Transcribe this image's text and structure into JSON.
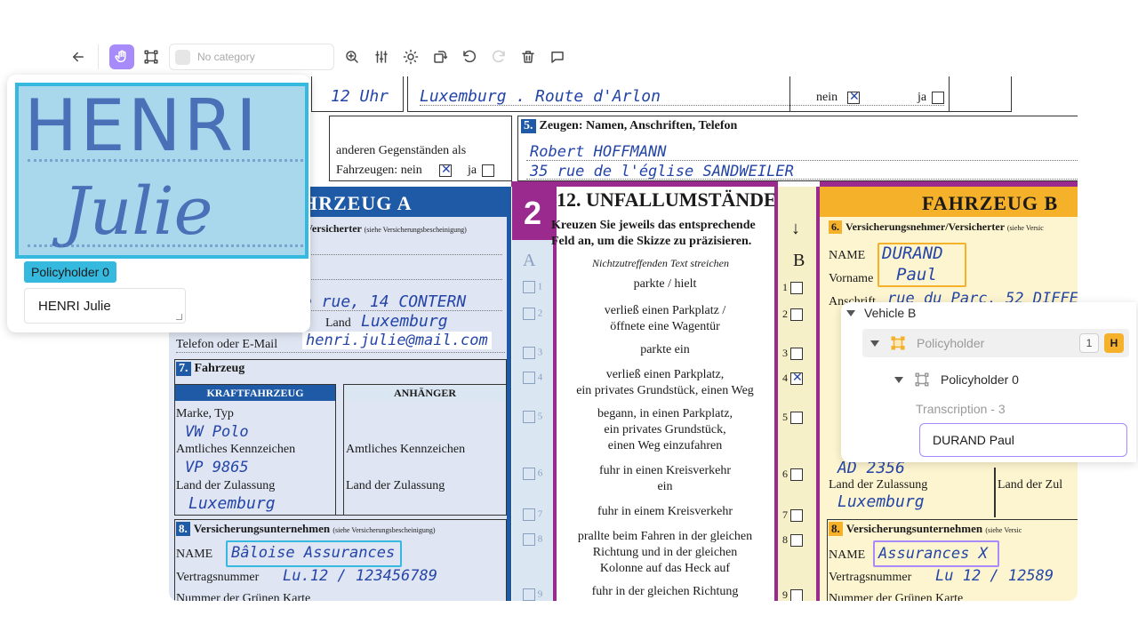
{
  "toolbar": {
    "category_placeholder": "No category"
  },
  "doc": {
    "uhr": "12 Uhr",
    "place_hw": "Luxemburg . Route d'Arlon",
    "nein": "nein",
    "ja": "ja",
    "sec5_num": "5.",
    "sec5_title": "Zeugen: Namen, Anschriften, Telefon",
    "witness_line1": "Robert HOFFMANN",
    "witness_line2": "35 rue de l'église SANDWEILER",
    "other_objects": "anderen Gegenständen als",
    "vehicles_nein": "Fahrzeugen: nein",
    "fahrzeug_a": "HRZEUG A",
    "insured_a": "/Versicherter",
    "insured_a_note": "(siehe Versicherungsbescheinigung)",
    "address_hw": "e rue, 14 CONTERN",
    "land_label": "Land",
    "land_hw": "Luxemburg",
    "phone_label": "Telefon oder E-Mail",
    "email_hw": "henri.julie@mail.com",
    "sec7_num": "7.",
    "sec7_title": "Fahrzeug",
    "kraftfahrzeug": "KRAFTFAHRZEUG",
    "anhaenger": "ANHÄNGER",
    "marke_typ": "Marke, Typ",
    "marke_hw": "VW Polo",
    "kennzeichen": "Amtliches Kennzeichen",
    "kennzeichen_hw": "VP 9865",
    "kennzeichen2": "Amtliches Kennzeichen",
    "zulassung": "Land der Zulassung",
    "zulassung_hw": "Luxemburg",
    "zulassung2": "Land der Zulassung",
    "sec8_num": "8.",
    "sec8_title": "Versicherungsunternehmen",
    "sec8_note": "(siehe Versicherungsbescheinigung)",
    "name_label": "NAME",
    "insurer_a_hw": "Bâloise Assurances",
    "vertrag": "Vertragsnummer",
    "vertrag_a_hw": "Lu.12 / 123456789",
    "gruene_karte": "Nummer der Grünen Karte",
    "badge2": "2",
    "sec12_title": "12. UNFALLUMSTÄNDE",
    "sec12_inst1": "Kreuzen Sie jeweils das entsprechende",
    "sec12_inst2": "Feld an, um die Skizze zu präzisieren.",
    "sec12_inst3": "Nichtzutreffenden Text streichen",
    "col_a": "A",
    "col_b": "B",
    "circumstances": [
      {
        "n": "1",
        "t1": "parkte / hielt",
        "t2": ""
      },
      {
        "n": "2",
        "t1": "verließ einen Parkplatz /",
        "t2": "öffnete eine Wagentür"
      },
      {
        "n": "3",
        "t1": "parkte ein",
        "t2": ""
      },
      {
        "n": "4",
        "t1": "verließ einen Parkplatz,",
        "t2": "ein privates Grundstück, einen Weg"
      },
      {
        "n": "5",
        "t1": "begann, in einen Parkplatz,",
        "t2": "ein privates Grundstück,",
        "t3": "einen Weg einzufahren"
      },
      {
        "n": "6",
        "t1": "fuhr in einen Kreisverkehr",
        "t2": "ein"
      },
      {
        "n": "7",
        "t1": "fuhr in einem Kreisverkehr",
        "t2": ""
      },
      {
        "n": "8",
        "t1": "prallte beim Fahren in der gleichen",
        "t2": "Richtung und in der gleichen",
        "t3": "Kolonne auf das Heck auf"
      },
      {
        "n": "9",
        "t1": "fuhr in der gleichen Richtung",
        "t2": ""
      }
    ],
    "fahrzeug_b": "FAHRZEUG B",
    "sec6_num": "6.",
    "insured_b": "Versicherungsnehmer/Versicherter",
    "insured_b_note": "(siehe Versic",
    "name_b_hw1": "DURAND",
    "name_b_hw2": "Paul",
    "vorname": "Vorname",
    "anschrift": "Anschrift",
    "anschrift_hw": "rue du Parc, 52 DIFFER",
    "plate_b_hw": "AD 2356",
    "zulassung_b": "Land der Zulassung",
    "zulassung_b_hw": "Luxemburg",
    "zulassung_b2": "Land der Zul",
    "insurer_b_hw": "Assurances X",
    "vertrag_b_hw": "Lu 12 / 12589",
    "gruene_karte_b": "Nummer der Grünen Karte"
  },
  "zoom": {
    "img_line1": "HENRI",
    "img_line2": "Julie",
    "tag": "Policyholder 0",
    "value": "HENRI Julie"
  },
  "tree": {
    "root": "Vehicle B",
    "group": "Policyholder",
    "group_count": "1",
    "group_badge": "H",
    "item": "Policyholder 0",
    "sub": "Transcription - 3",
    "value": "DURAND Paul"
  },
  "colors": {
    "accent_purple": "#a78bfa",
    "tag_cyan": "#36b9de",
    "vehicle_a_blue": "#1f5aa6",
    "vehicle_b_yellow": "#f6b12a",
    "magenta": "#9b2a8f"
  }
}
